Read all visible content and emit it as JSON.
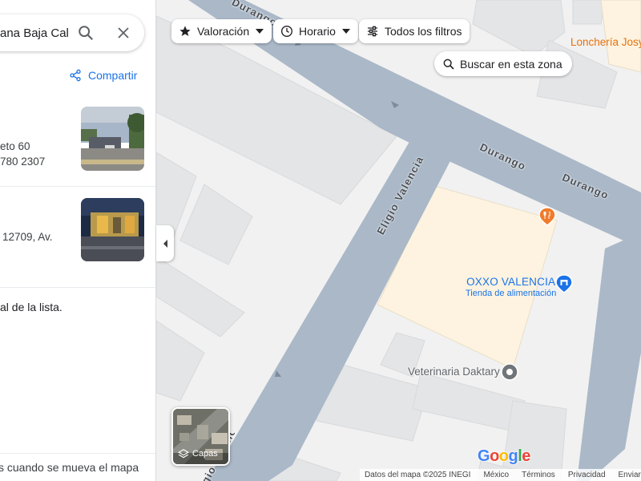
{
  "search": {
    "query": "ana Baja Cal"
  },
  "share": {
    "label": "Compartir"
  },
  "results": [
    {
      "line1": "eto 60",
      "line2": "780 2307"
    },
    {
      "line1": "12709, Av."
    }
  ],
  "list_end_text": "al de la lista.",
  "bottom_note": "s cuando se mueva el mapa",
  "filters": {
    "rating": "Valoración",
    "hours": "Horario",
    "all": "Todos los filtros"
  },
  "search_area": "Buscar en esta zona",
  "map_labels": {
    "durango_top": "Durango",
    "durango_mid": "Durango",
    "durango_right": "Durango",
    "eligio_valencia": "Eligio Valencia",
    "eligio_valencia_bottom": "Eligio Valencia",
    "loncheria": "Lonchería Josy",
    "oxxo_name": "OXXO VALENCIA",
    "oxxo_category": "Tienda de alimentación",
    "veterinaria": "Veterinaria Daktary"
  },
  "layers": {
    "label": "Capas"
  },
  "google_logo": {
    "letters": [
      "G",
      "o",
      "o",
      "g",
      "l",
      "e"
    ],
    "colors": [
      "#4285F4",
      "#EA4335",
      "#FBBC05",
      "#4285F4",
      "#34A853",
      "#EA4335"
    ]
  },
  "footer": {
    "data": "Datos del mapa ©2025 INEGI",
    "country": "México",
    "terms": "Términos",
    "privacy": "Privacidad",
    "feedback": "Enviar comentarios"
  },
  "colors": {
    "road": "#aab8c8",
    "building": "#e6e6e6",
    "lot": "#fdf3e0",
    "link": "#1a73e8",
    "restaurant": "#f07b2c",
    "shop": "#1a73e8",
    "poi_gray": "#70757a"
  }
}
